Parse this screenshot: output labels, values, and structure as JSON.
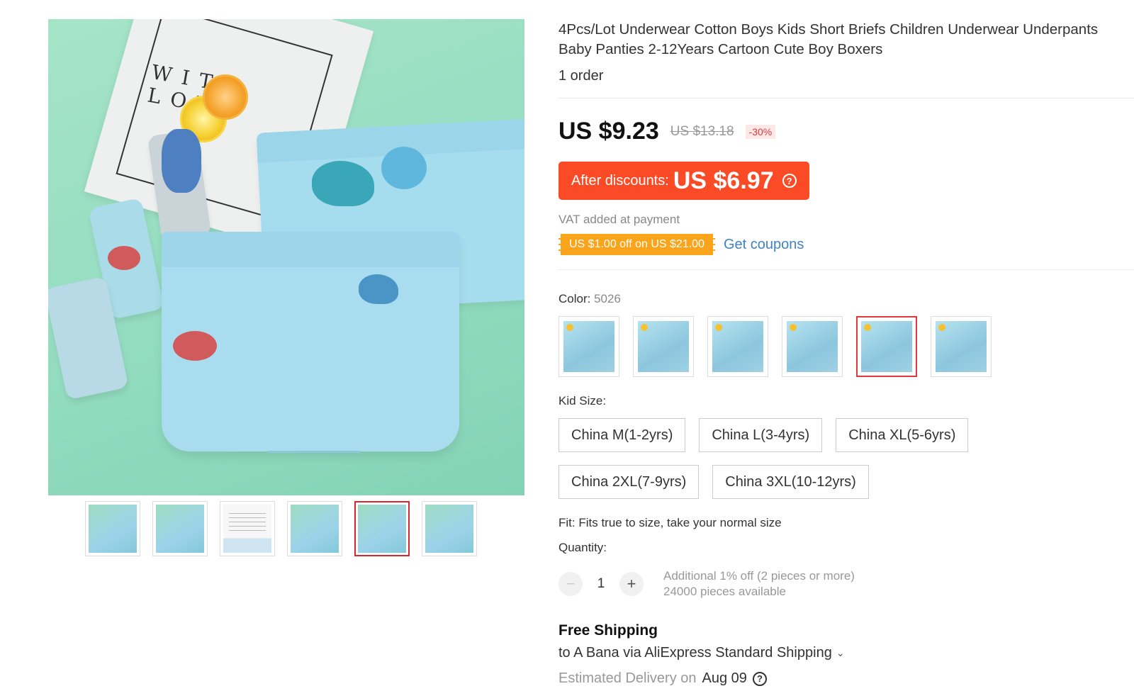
{
  "product": {
    "title_line1": "4Pcs/Lot Underwear Cotton Boys Kids Short Briefs Children Underwear Underpants",
    "title_line2": "Baby Panties 2-12Years Cartoon Cute Boy Boxers",
    "orders": "1 order"
  },
  "gallery": {
    "main_image_text": "WITH LOVE",
    "thumbnails": [
      {
        "icon": "product-photo",
        "active": false
      },
      {
        "icon": "product-photo",
        "active": false
      },
      {
        "icon": "size-chart",
        "active": false
      },
      {
        "icon": "product-photo",
        "active": false
      },
      {
        "icon": "product-photo",
        "active": true
      },
      {
        "icon": "product-photo",
        "active": false
      }
    ]
  },
  "price": {
    "current": "US $9.23",
    "original": "US $13.18",
    "discount": "-30%",
    "after_discounts_label": "After discounts:",
    "after_discounts_price": "US $6.97",
    "vat_note": "VAT added at payment"
  },
  "coupon": {
    "tag": "US $1.00 off on US $21.00",
    "link": "Get coupons"
  },
  "color": {
    "label": "Color:",
    "selected": "5026",
    "swatch_count": 6,
    "active_index": 4
  },
  "size": {
    "label": "Kid Size:",
    "options": [
      "China M(1-2yrs)",
      "China L(3-4yrs)",
      "China XL(5-6yrs)",
      "China 2XL(7-9yrs)",
      "China 3XL(10-12yrs)"
    ]
  },
  "fit": "Fit: Fits true to size, take your normal size",
  "quantity": {
    "label": "Quantity:",
    "minus": "−",
    "plus": "+",
    "value": "1",
    "note1": "Additional 1% off (2 pieces or more)",
    "note2": "24000 pieces available"
  },
  "shipping": {
    "title": "Free Shipping",
    "method": "to A Bana via AliExpress Standard Shipping",
    "delivery_label": "Estimated Delivery on",
    "delivery_date": "Aug 09"
  },
  "colors": {
    "accent_red": "#fa4a26",
    "active_border": "#e4393c",
    "coupon_orange": "#f9a41b",
    "link_blue": "#3f83c4"
  }
}
